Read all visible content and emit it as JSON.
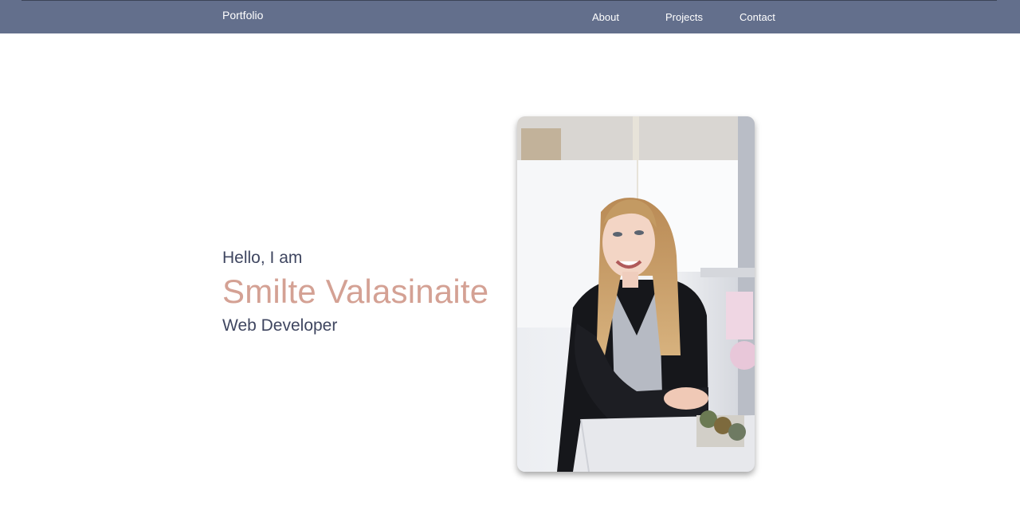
{
  "navbar": {
    "brand": "Portfolio",
    "links": [
      "About",
      "Projects",
      "Contact"
    ],
    "background_color": "#636f8c"
  },
  "hero": {
    "greeting": "Hello, I am",
    "name": "Smilte Valasinaite",
    "role": "Web Developer",
    "accent_color": "#d4a194",
    "text_color": "#3f4660"
  },
  "portrait": {
    "icon": "profile-photo"
  }
}
